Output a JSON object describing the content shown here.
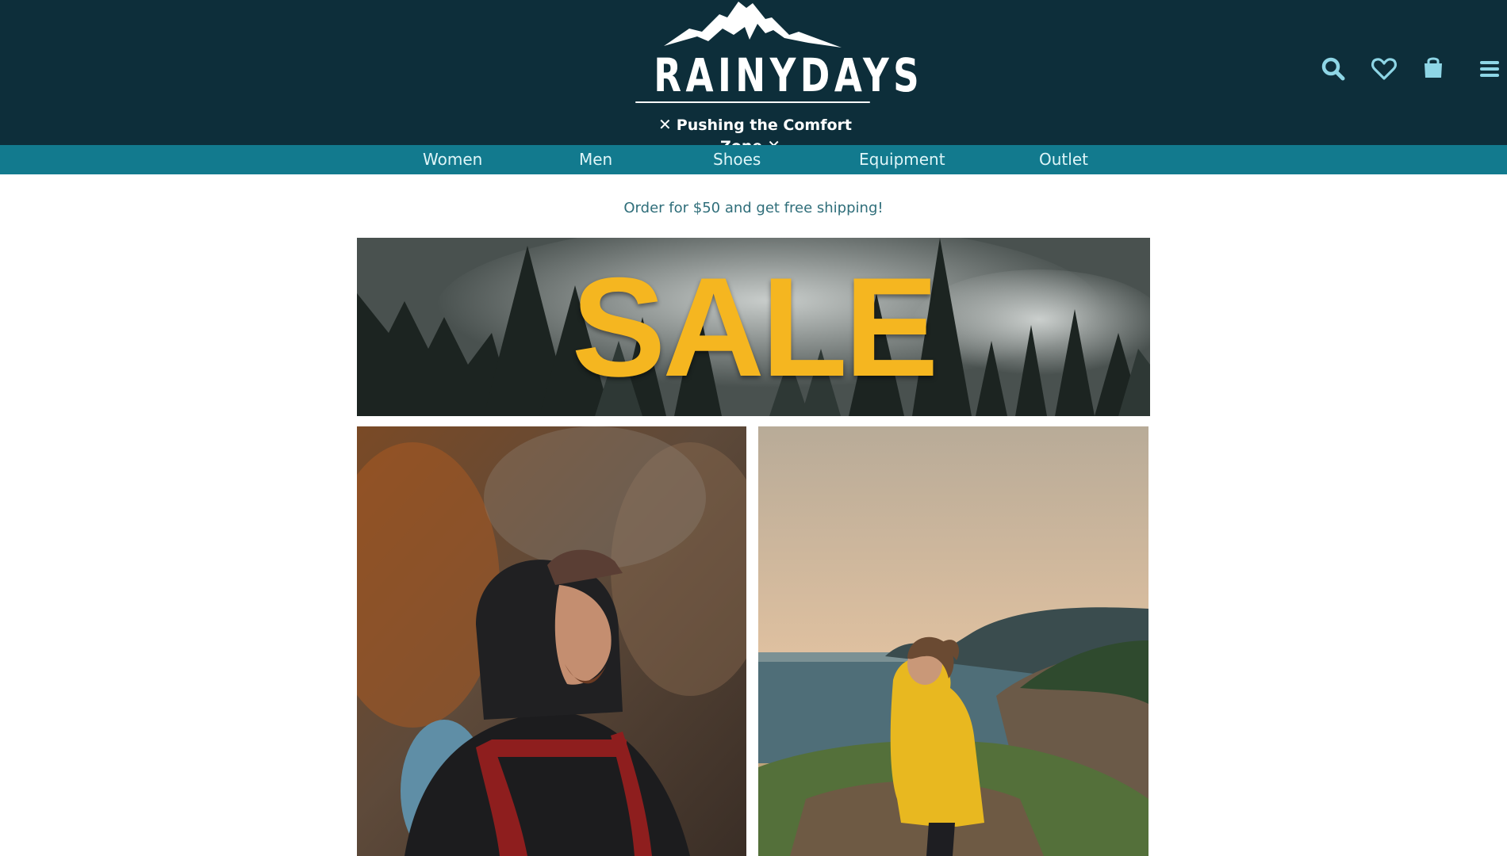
{
  "header": {
    "brand": "RAINYDAYS",
    "tagline": "Pushing the Comfort Zone",
    "icons": {
      "search": "search-icon",
      "wishlist": "heart-icon",
      "cart": "shopping-bag-icon",
      "menu": "hamburger-menu-icon"
    }
  },
  "nav": {
    "items": [
      {
        "label": "Women"
      },
      {
        "label": "Men"
      },
      {
        "label": "Shoes"
      },
      {
        "label": "Equipment"
      },
      {
        "label": "Outlet"
      }
    ]
  },
  "promo": {
    "shipping_text": "Order for $50 and get free shipping!"
  },
  "banner": {
    "sale_text": "SALE"
  },
  "colors": {
    "header_bg": "#0d2e3a",
    "nav_bg": "#127a8e",
    "icon_color": "#8ed6e6",
    "sale_yellow": "#f5b620",
    "shipping_text": "#2f6e7a"
  }
}
